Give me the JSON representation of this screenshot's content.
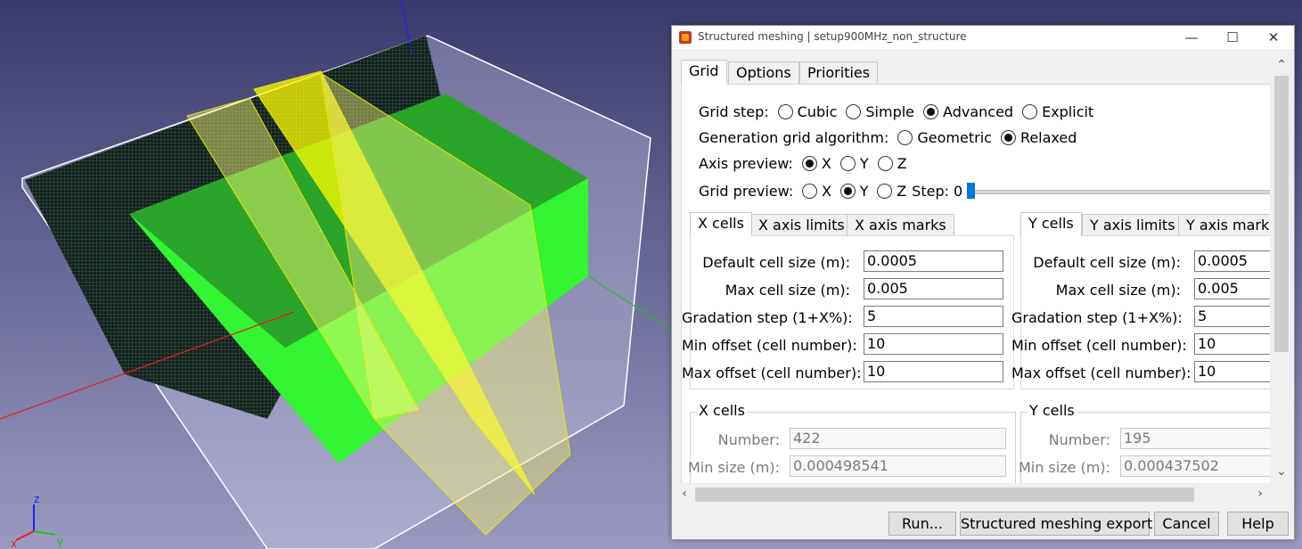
{
  "viewport": {
    "axes": {
      "x_label": "x",
      "y_label": "y",
      "z_label": "z"
    },
    "colors": {
      "background_top": "#3a3a6e",
      "background_bottom": "#9a9ac0",
      "solid": "#33ee33",
      "solid_top": "#2aa02a",
      "plane": "#ffff00",
      "mesh": "#1a3a2a"
    }
  },
  "dialog": {
    "title": "Structured meshing | setup900MHz_non_structure",
    "window_buttons": {
      "minimize": "—",
      "maximize": "☐",
      "close": "✕"
    },
    "tabs": [
      "Grid",
      "Options",
      "Priorities"
    ],
    "grid": {
      "grid_step": {
        "label": "Grid step:",
        "options": [
          "Cubic",
          "Simple",
          "Advanced",
          "Explicit"
        ],
        "selected": "Advanced"
      },
      "generation": {
        "label": "Generation grid algorithm:",
        "options": [
          "Geometric",
          "Relaxed"
        ],
        "selected": "Relaxed"
      },
      "axis_preview": {
        "label": "Axis preview:",
        "options": [
          "X",
          "Y",
          "Z"
        ],
        "selected": "X"
      },
      "grid_preview": {
        "label": "Grid preview:",
        "options": [
          "X",
          "Y",
          "Z"
        ],
        "selected": "Y",
        "step_label": "Step:",
        "step_value": "0"
      }
    },
    "x_panel": {
      "tabs": [
        "X cells",
        "X axis limits",
        "X axis marks"
      ],
      "fields": [
        {
          "label": "Default cell size (m):",
          "value": "0.0005"
        },
        {
          "label": "Max cell size (m):",
          "value": "0.005"
        },
        {
          "label": "Gradation step (1+X%):",
          "value": "5"
        },
        {
          "label": "Min offset (cell number):",
          "value": "10"
        },
        {
          "label": "Max offset (cell number):",
          "value": "10"
        }
      ],
      "group_title": "X cells",
      "info": [
        {
          "label": "Number:",
          "value": "422"
        },
        {
          "label": "Min size (m):",
          "value": "0.000498541"
        }
      ]
    },
    "y_panel": {
      "tabs": [
        "Y cells",
        "Y axis limits",
        "Y axis marks"
      ],
      "fields": [
        {
          "label": "Default cell size (m):",
          "value": "0.0005"
        },
        {
          "label": "Max cell size (m):",
          "value": "0.005"
        },
        {
          "label": "Gradation step (1+X%):",
          "value": "5"
        },
        {
          "label": "Min offset (cell number):",
          "value": "10"
        },
        {
          "label": "Max offset (cell number):",
          "value": "10"
        }
      ],
      "group_title": "Y cells",
      "info": [
        {
          "label": "Number:",
          "value": "195"
        },
        {
          "label": "Min size (m):",
          "value": "0.000437502"
        }
      ]
    },
    "buttons": {
      "run": "Run...",
      "export": "Structured meshing export...",
      "cancel": "Cancel",
      "help": "Help"
    }
  }
}
